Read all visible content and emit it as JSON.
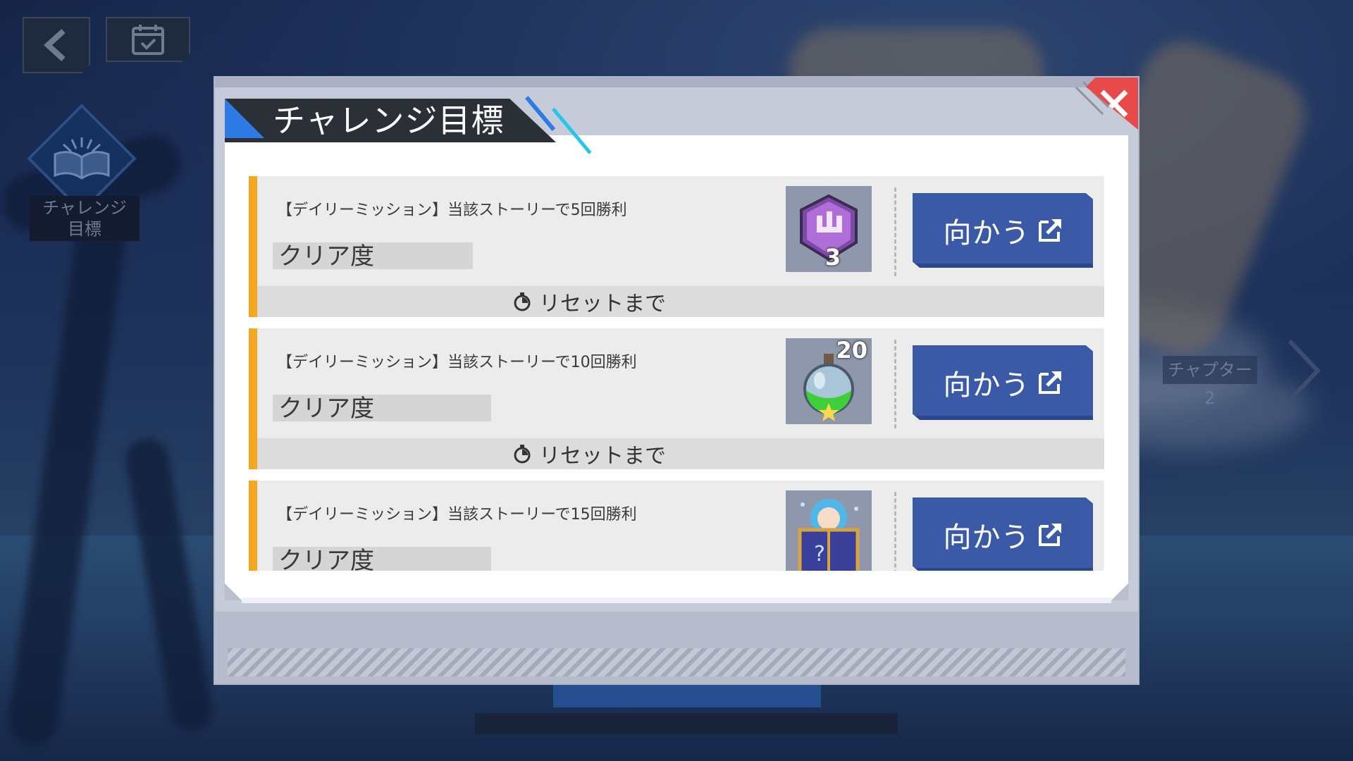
{
  "hud": {
    "side_label_line1": "チャレンジ",
    "side_label_line2": "目標",
    "chapter_label": "チャプター2"
  },
  "modal": {
    "title": "チャレンジ目標"
  },
  "missions": [
    {
      "title": "【デイリーミッション】当該ストーリーで5回勝利",
      "clear_label": "クリア度",
      "reset_label": "リセットまで",
      "reward_icon": "purple-emblem-icon",
      "reward_count": "3",
      "button_label": "向かう"
    },
    {
      "title": "【デイリーミッション】当該ストーリーで10回勝利",
      "clear_label": "クリア度",
      "reset_label": "リセットまで",
      "reward_icon": "green-potion-icon",
      "reward_count": "20",
      "button_label": "向かう"
    },
    {
      "title": "【デイリーミッション】当該ストーリーで15回勝利",
      "clear_label": "クリア度",
      "reset_label": "",
      "reward_icon": "mystery-box-icon",
      "reward_count": "",
      "button_label": "向かう"
    }
  ],
  "colors": {
    "accent_orange": "#f5a623",
    "button_blue": "#3a5aa8",
    "close_red": "#e84a4a",
    "title_dark": "#2b2f36"
  }
}
